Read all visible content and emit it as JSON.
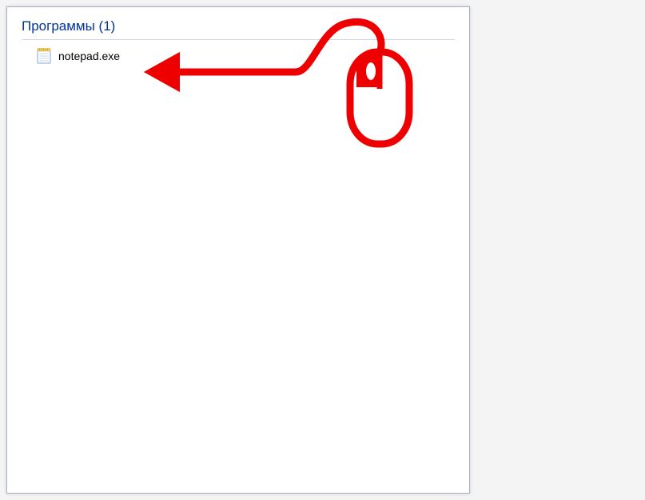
{
  "header": {
    "title": "Программы (1)"
  },
  "results": {
    "items": [
      {
        "icon": "notepad-icon",
        "label": "notepad.exe"
      }
    ]
  },
  "annotation": {
    "color": "#ee0000"
  }
}
